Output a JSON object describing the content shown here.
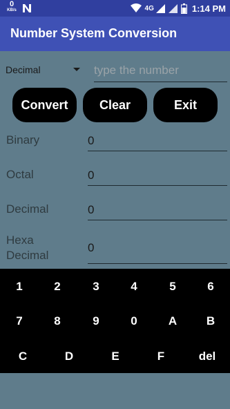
{
  "status_bar": {
    "speed_value": "0",
    "speed_unit": "KB/s",
    "network": "4G",
    "time": "1:14 PM"
  },
  "toolbar": {
    "title": "Number System Conversion"
  },
  "input": {
    "base_selected": "Decimal",
    "placeholder": "type the number",
    "value": ""
  },
  "buttons": {
    "convert": "Convert",
    "clear": "Clear",
    "exit": "Exit"
  },
  "results": {
    "binary": {
      "label": "Binary",
      "value": "0"
    },
    "octal": {
      "label": "Octal",
      "value": "0"
    },
    "decimal": {
      "label": "Decimal",
      "value": "0"
    },
    "hexa": {
      "label": "Hexa\nDecimal",
      "value": "0"
    }
  },
  "keypad": {
    "row1": [
      "1",
      "2",
      "3",
      "4",
      "5",
      "6"
    ],
    "row2": [
      "7",
      "8",
      "9",
      "0",
      "A",
      "B"
    ],
    "row3": [
      "C",
      "D",
      "E",
      "F",
      "del"
    ]
  },
  "colors": {
    "background": "#5F7C8B",
    "status_bar": "#303F9F",
    "toolbar": "#3F51B5",
    "button": "#000000",
    "keypad": "#000000"
  }
}
